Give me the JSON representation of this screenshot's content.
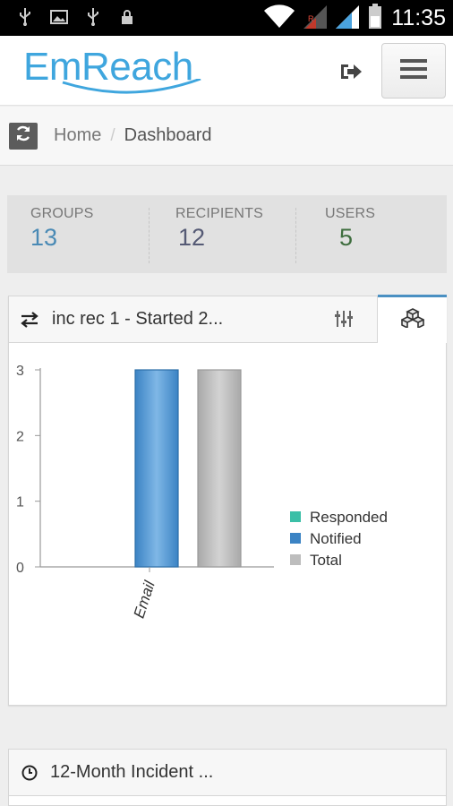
{
  "status_bar": {
    "time": "11:35",
    "left_icons": [
      "usb-icon",
      "image-icon",
      "usb-icon",
      "lock-icon"
    ],
    "right_icons": [
      "wifi-icon",
      "signal-no-data-icon",
      "signal-icon",
      "battery-icon"
    ]
  },
  "header": {
    "logo_text": "EmReach",
    "logo_color": "#3fa6de",
    "logout_icon": "logout-icon",
    "menu_icon": "hamburger-menu-icon"
  },
  "breadcrumb": {
    "refresh_icon": "refresh-icon",
    "home": "Home",
    "separator": "/",
    "current": "Dashboard"
  },
  "stats": [
    {
      "label": "GROUPS",
      "value": "13",
      "color": "#4a8ab5"
    },
    {
      "label": "RECIPIENTS",
      "value": "12",
      "color": "#555a75"
    },
    {
      "label": "USERS",
      "value": "5",
      "color": "#3f6e3f"
    }
  ],
  "chart_panel": {
    "title_icon": "exchange-arrows-icon",
    "title": "inc rec 1 - Started 2...",
    "settings_icon": "sliders-icon",
    "tab_icon": "cubes-icon"
  },
  "chart_data": {
    "type": "bar",
    "categories": [
      "Email"
    ],
    "series": [
      {
        "name": "Responded",
        "values": [
          0
        ],
        "color": "#3bbfa7"
      },
      {
        "name": "Notified",
        "values": [
          3
        ],
        "color": "#3b83c4"
      },
      {
        "name": "Total",
        "values": [
          3
        ],
        "color": "#bdbdbd"
      }
    ],
    "yticks": [
      0,
      1,
      2,
      3
    ],
    "ylim": [
      0,
      3
    ],
    "grid": false,
    "legend_position": "right"
  },
  "second_panel": {
    "icon": "clock-icon",
    "title": "12-Month Incident ..."
  }
}
